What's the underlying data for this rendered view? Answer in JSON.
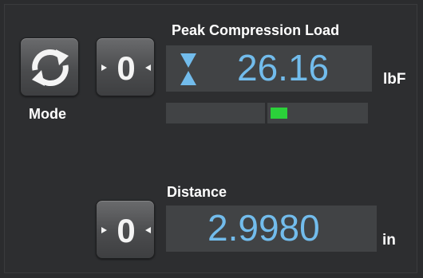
{
  "mode": {
    "label": "Mode",
    "icon": "refresh-cycle-icon"
  },
  "load": {
    "title": "Peak Compression Load",
    "value": "26.16",
    "unit": "lbF",
    "indicator_icon": "hourglass-peak-icon",
    "zero_icon": "zero-tare-icon",
    "bar_indicator_color": "#2bd13a"
  },
  "distance": {
    "title": "Distance",
    "value": "2.9980",
    "unit": "in",
    "zero_icon": "zero-tare-icon"
  },
  "colors": {
    "value_text": "#72bcec",
    "background": "#2d2e30",
    "value_box": "#414345"
  }
}
